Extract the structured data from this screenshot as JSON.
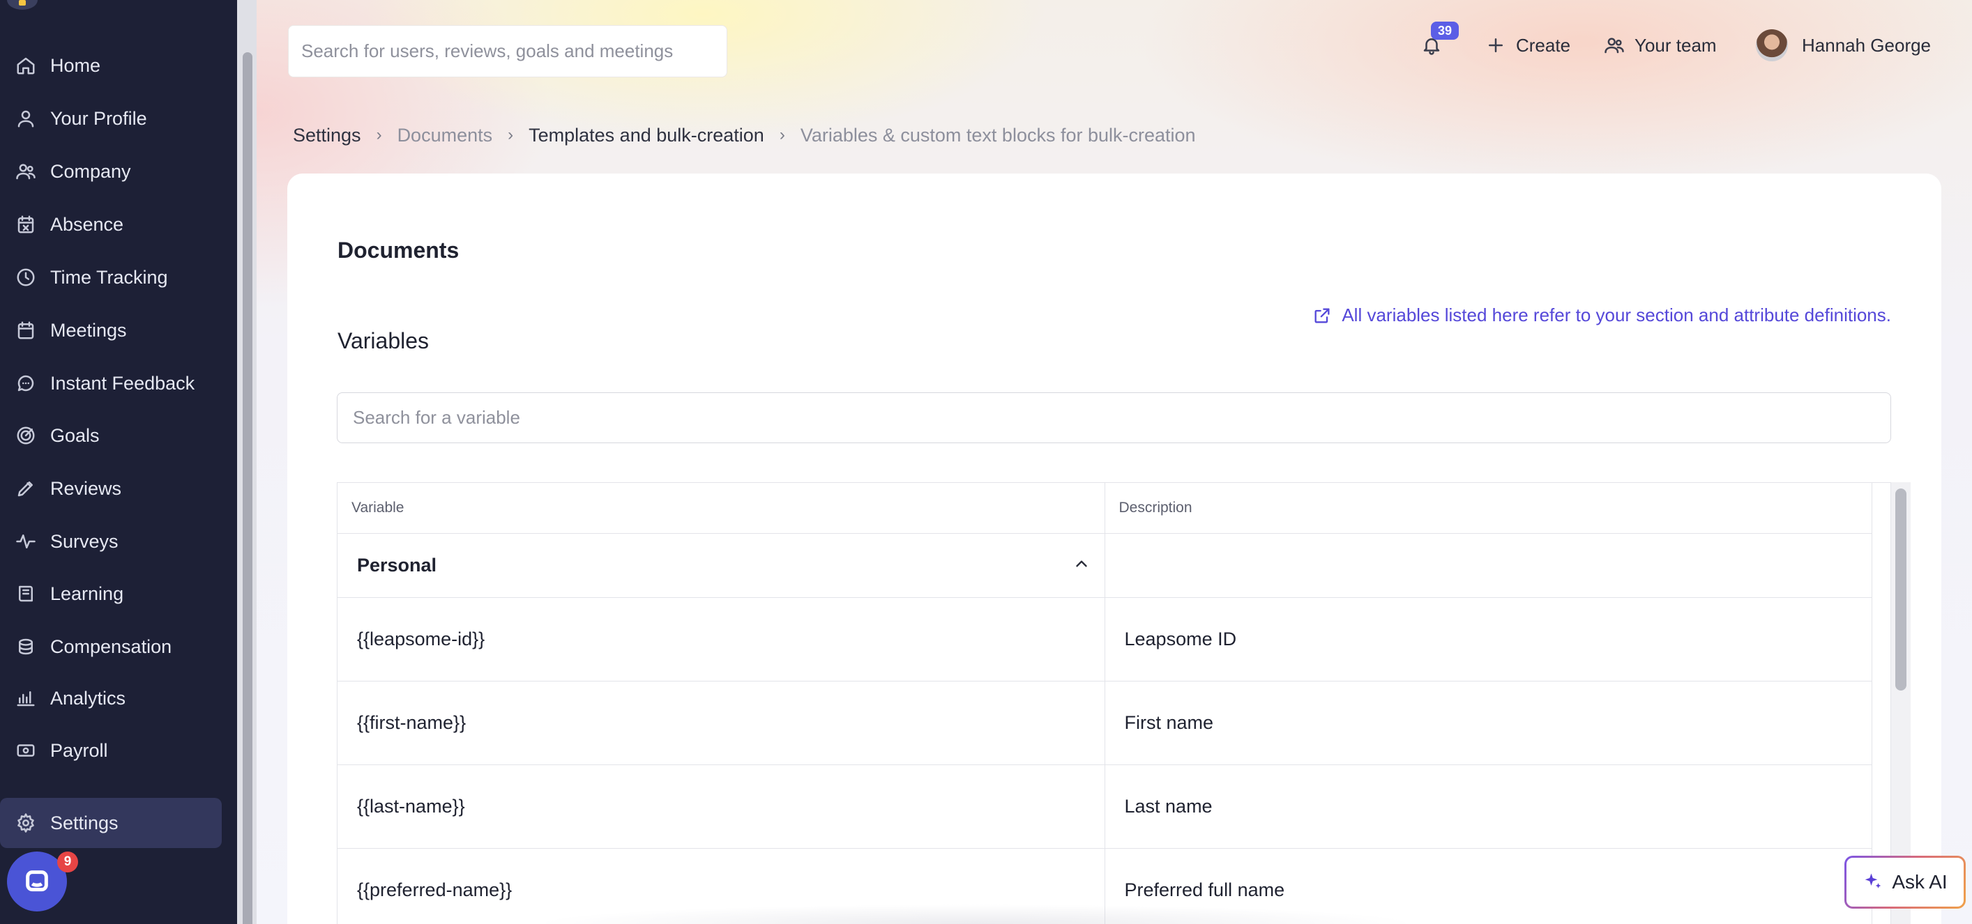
{
  "sidebar": {
    "items": [
      {
        "label": "Home",
        "icon": "home-icon"
      },
      {
        "label": "Your Profile",
        "icon": "user-icon"
      },
      {
        "label": "Company",
        "icon": "company-icon"
      },
      {
        "label": "Absence",
        "icon": "calendar-x-icon"
      },
      {
        "label": "Time Tracking",
        "icon": "clock-icon"
      },
      {
        "label": "Meetings",
        "icon": "calendar-icon"
      },
      {
        "label": "Instant Feedback",
        "icon": "chat-icon"
      },
      {
        "label": "Goals",
        "icon": "target-icon"
      },
      {
        "label": "Reviews",
        "icon": "pencil-icon"
      },
      {
        "label": "Surveys",
        "icon": "pulse-icon"
      },
      {
        "label": "Learning",
        "icon": "book-icon"
      },
      {
        "label": "Compensation",
        "icon": "coins-icon"
      },
      {
        "label": "Analytics",
        "icon": "chart-icon"
      },
      {
        "label": "Payroll",
        "icon": "banknote-icon"
      },
      {
        "label": "Settings",
        "icon": "gear-icon"
      }
    ],
    "chat_badge": "9"
  },
  "topbar": {
    "search_placeholder": "Search for users, reviews, goals and meetings",
    "notifications_count": "39",
    "create_label": "Create",
    "team_label": "Your team",
    "user_name": "Hannah George"
  },
  "breadcrumb": {
    "items": [
      "Settings",
      "Documents",
      "Templates and bulk-creation",
      "Variables & custom text blocks for bulk-creation"
    ]
  },
  "card": {
    "title": "Documents",
    "section_title": "Variables",
    "info_link": "All variables listed here refer to your section and attribute definitions.",
    "search_placeholder": "Search for a variable"
  },
  "table": {
    "headers": [
      "Variable",
      "Description"
    ],
    "group": "Personal",
    "rows": [
      {
        "variable": "{{leapsome-id}}",
        "description": "Leapsome ID"
      },
      {
        "variable": "{{first-name}}",
        "description": "First name"
      },
      {
        "variable": "{{last-name}}",
        "description": "Last name"
      },
      {
        "variable": "{{preferred-name}}",
        "description": "Preferred full name"
      }
    ]
  },
  "ask_ai": {
    "label": "Ask AI"
  },
  "colors": {
    "sidebar_bg": "#1d2036",
    "accent": "#5548d9",
    "badge": "#5b5ee6"
  }
}
